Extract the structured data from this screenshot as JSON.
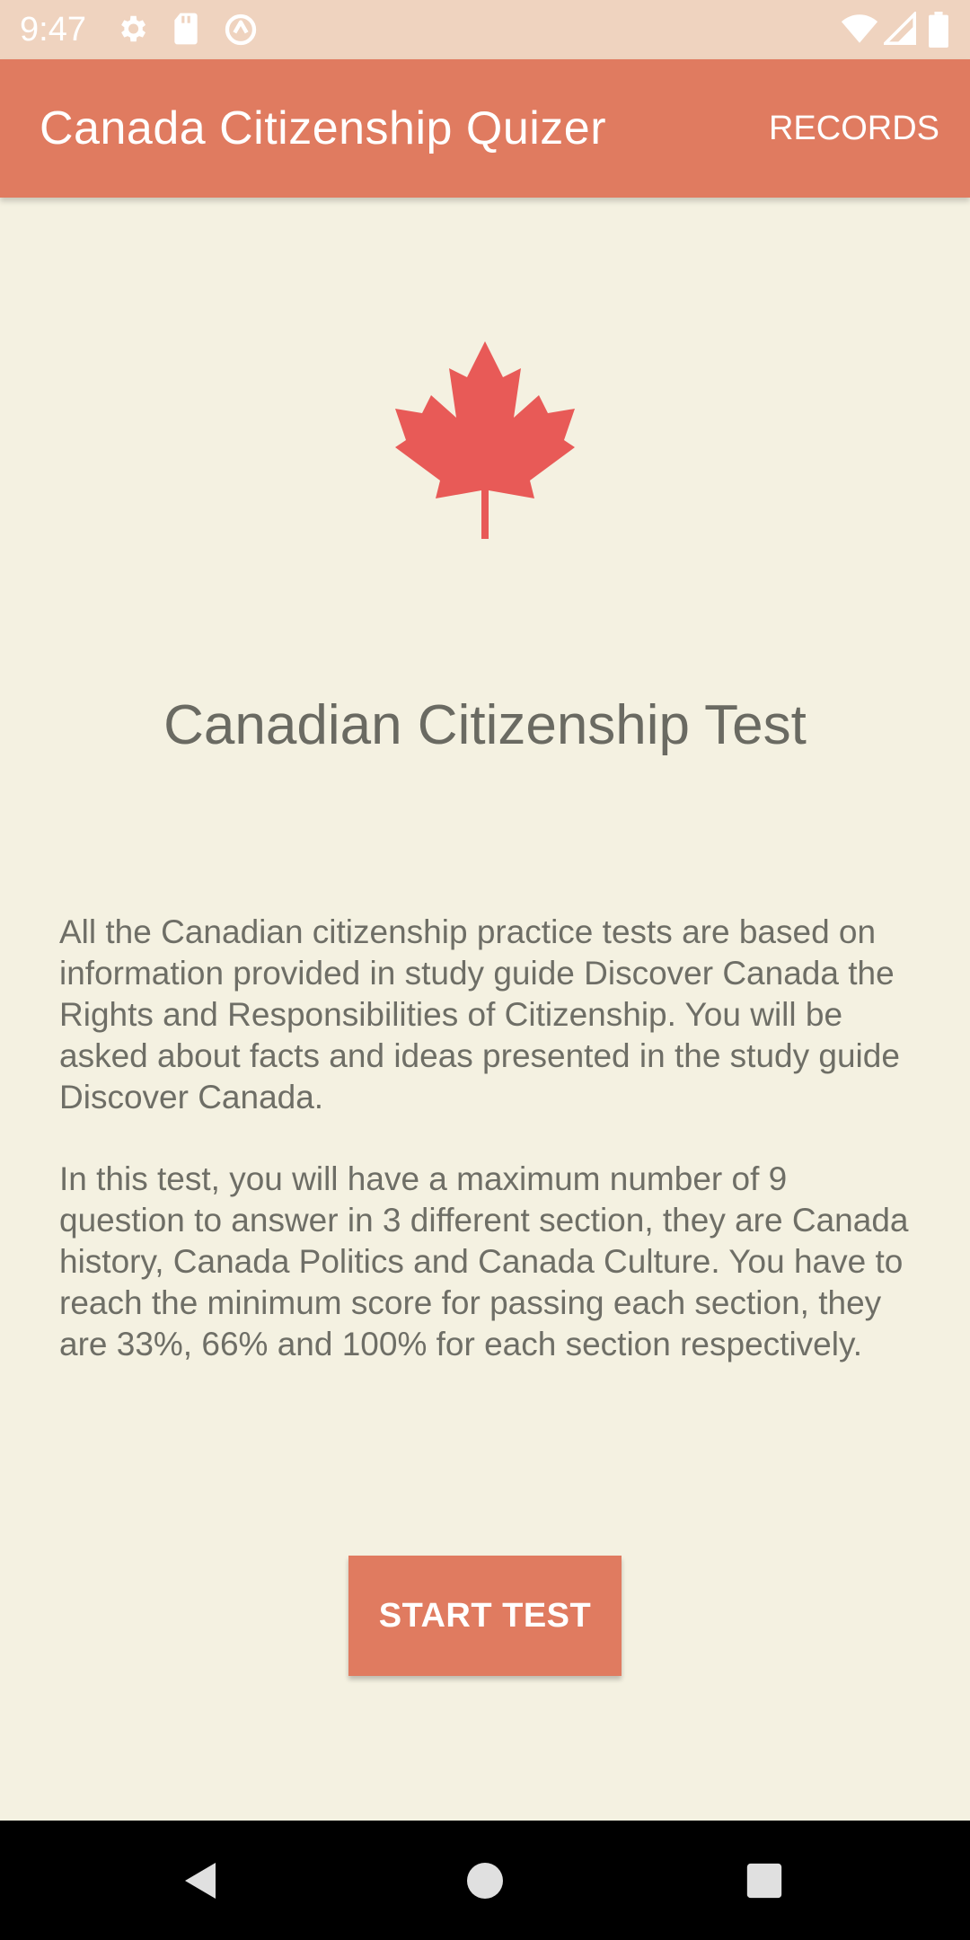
{
  "status_bar": {
    "time": "9:47",
    "icons": [
      "gear-icon",
      "sd-card-icon",
      "sync-icon",
      "wifi-icon",
      "signal-icon",
      "battery-icon"
    ]
  },
  "app_bar": {
    "title": "Canada Citizenship Quizer",
    "records_label": "RECORDS"
  },
  "main": {
    "logo_icon": "maple-leaf-icon",
    "heading": "Canadian Citizenship Test",
    "paragraph_1": "All the Canadian citizenship practice tests are based on information provided in study guide Discover Canada the Rights and Responsibilities of Citizenship. You will be asked about facts and ideas presented in the study guide Discover Canada.",
    "paragraph_2": "In this test, you will have a maximum number of 9 question to answer in 3 different section, they are Canada history, Canada Politics and Canada Culture. You have to reach the minimum score for passing each section, they are 33%, 66% and 100% for each section respectively.",
    "start_button_label": "START TEST"
  },
  "nav_bar": {
    "icons": [
      "back-icon",
      "home-icon",
      "recents-icon"
    ]
  },
  "colors": {
    "accent": "#e07b60",
    "status_bar": "#efd3bf",
    "background": "#f4f1e1",
    "maple_leaf": "#e85a57"
  }
}
